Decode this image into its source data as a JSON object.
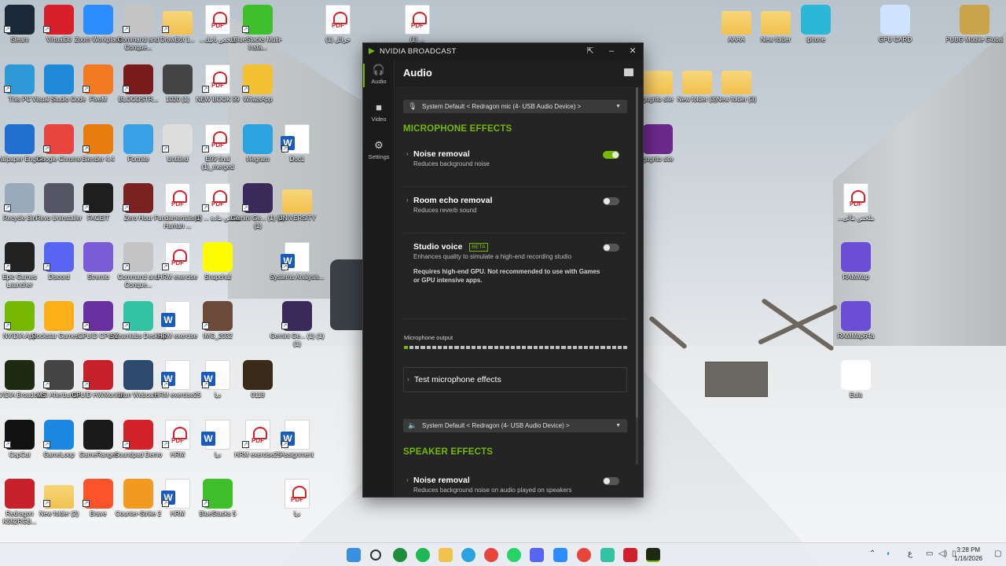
{
  "desktop": {
    "icons_left": [
      {
        "label": "Steam",
        "color": "#1b2838"
      },
      {
        "label": "VirtualDJ",
        "color": "#d8202a"
      },
      {
        "label": "Zoom Workplace",
        "color": "#2d8cff"
      },
      {
        "label": "Command and Conque...",
        "color": "#c4c4c4"
      },
      {
        "label": "DrawBot 1...",
        "color": "folder"
      },
      {
        "label": "...ملخص باتيك",
        "color": "pdf"
      },
      {
        "label": "BlueStacks Multi-Insta...",
        "color": "#3fbf2c"
      },
      {
        "label": "This PC",
        "color": "#2f98d6"
      },
      {
        "label": "Visual Studio Code",
        "color": "#1f8ad8"
      },
      {
        "label": "FiveM",
        "color": "#f37a22"
      },
      {
        "label": "BLOODSTR...",
        "color": "#7a1a1a"
      },
      {
        "label": "1020 (1)",
        "color": "#444"
      },
      {
        "label": "NEW BOOK 99",
        "color": "pdf"
      },
      {
        "label": "WhatsApp",
        "color": "#f2c230"
      },
      {
        "label": "Wallpaper Engine",
        "color": "#1f6fd0"
      },
      {
        "label": "Google Chrome",
        "color": "#e8453c"
      },
      {
        "label": "Blender 4.4",
        "color": "#e87d0d"
      },
      {
        "label": "Fortnite",
        "color": "#39a0e6"
      },
      {
        "label": "Untitled",
        "color": "#ddd"
      },
      {
        "label": "E99 final (1)_merged",
        "color": "pdf"
      },
      {
        "label": "t4egram",
        "color": "#2aa3e0"
      },
      {
        "label": "Doc1",
        "color": "word"
      },
      {
        "label": "Recycle Bin",
        "color": "#9ab"
      },
      {
        "label": "Revo Uninstaller",
        "color": "#556"
      },
      {
        "label": "FACEIT",
        "color": "#1e1e1e"
      },
      {
        "label": "Zero Hour",
        "color": "#7a2222"
      },
      {
        "label": "Fundamentals of Human ...",
        "color": "pdf"
      },
      {
        "label": "ملخص مادة ... (1)",
        "color": "pdf"
      },
      {
        "label": "Gemini Ge... (1) (1) (1)",
        "color": "#3a2a5a"
      },
      {
        "label": "UNIVERSITY",
        "color": "folder"
      },
      {
        "label": "Epic Games Launcher",
        "color": "#222"
      },
      {
        "label": "Discord",
        "color": "#5865f2"
      },
      {
        "label": "Stremio",
        "color": "#7b5bd6"
      },
      {
        "label": "Command and Conque...",
        "color": "#c4c4c4"
      },
      {
        "label": "HRM exercise",
        "color": "pdf"
      },
      {
        "label": "Snapchat",
        "color": "#fffc00"
      },
      {
        "label": "Systems Analysis...",
        "color": "word"
      },
      {
        "label": "NVIDIA App",
        "color": "#76b900"
      },
      {
        "label": "Rockstar Games ...",
        "color": "#fcaf17"
      },
      {
        "label": "CPUID CPU-Z",
        "color": "#6a2fa0"
      },
      {
        "label": "Streamlabs Desktop",
        "color": "#31c3a2"
      },
      {
        "label": "HRM exercise",
        "color": "word"
      },
      {
        "label": "IMG_2032",
        "color": "#6b4a3a"
      },
      {
        "label": "Gemini Ge... (1) (1) (1)",
        "color": "#3a2a5a"
      },
      {
        "label": "NVIDIA Broadcast",
        "color": "#1f2a12"
      },
      {
        "label": "MSI Afterburner",
        "color": "#444"
      },
      {
        "label": "CPUID HWMonitor",
        "color": "#c8202a"
      },
      {
        "label": "Iriun Webcam",
        "color": "#2c4a6c"
      },
      {
        "label": "HRM exercise25",
        "color": "word"
      },
      {
        "label": "دیا",
        "color": "word"
      },
      {
        "label": "0118",
        "color": "#3a2a1a"
      },
      {
        "label": "CapCut",
        "color": "#111"
      },
      {
        "label": "GameLoop",
        "color": "#1c87e0"
      },
      {
        "label": "GameRanger",
        "color": "#1a1a1a"
      },
      {
        "label": "Soundpad Demo",
        "color": "#d2232a"
      },
      {
        "label": "HRM",
        "color": "pdf"
      },
      {
        "label": "دیا",
        "color": "word"
      },
      {
        "label": "HRM exercise25",
        "color": "pdf"
      },
      {
        "label": "Assignment",
        "color": "word"
      },
      {
        "label": "Redragon K552RGB...",
        "color": "#c8202a"
      },
      {
        "label": "New folder (2)",
        "color": "folder"
      },
      {
        "label": "Brave",
        "color": "#fb542b"
      },
      {
        "label": "Counter-Strike 2",
        "color": "#f29a1f"
      },
      {
        "label": "HRM",
        "color": "word"
      },
      {
        "label": "BlueStacks 5",
        "color": "#3fbf2c"
      },
      {
        "label": "دیا",
        "color": "pdf"
      }
    ],
    "icons_right": [
      {
        "label": "AAAA",
        "color": "folder"
      },
      {
        "label": "New folder",
        "color": "folder"
      },
      {
        "label": "iphone",
        "color": "#2bb8d8"
      },
      {
        "label": "GPU CARD",
        "color": "#cfe3ff"
      },
      {
        "label": "PUBG Mobile Global",
        "color": "#c9a44a"
      },
      {
        "label": "gugrito site",
        "color": "folder"
      },
      {
        "label": "New folder (3)",
        "color": "folder"
      },
      {
        "label": "New folder (3)",
        "color": "folder"
      },
      {
        "label": "gugrito site",
        "color": "#6b2a8a"
      },
      {
        "label": "...ملخص هالى",
        "color": "pdf"
      },
      {
        "label": "RAMMap",
        "color": "#6a4fd6"
      },
      {
        "label": "RAMMap64a",
        "color": "#6a4fd6"
      },
      {
        "label": "Eula",
        "color": "#fff"
      }
    ],
    "icons_top_mid": [
      {
        "label": "(1) حرائل",
        "color": "pdf"
      },
      {
        "label": "(1) ...",
        "color": "pdf"
      }
    ]
  },
  "window": {
    "title": "NVIDIA BROADCAST",
    "nav": [
      {
        "label": "Audio",
        "icon": "headset-icon",
        "active": true
      },
      {
        "label": "Video",
        "icon": "camera-icon",
        "active": false
      },
      {
        "label": "Settings",
        "icon": "gear-icon",
        "active": false
      }
    ],
    "page_title": "Audio",
    "mic_device": "System Default < Redragon mic (4- USB Audio Device) >",
    "mic_section_title": "MICROPHONE EFFECTS",
    "mic_effects": [
      {
        "name": "Noise removal",
        "desc": "Reduces background noise",
        "enabled": true
      },
      {
        "name": "Room echo removal",
        "desc": "Reduces reverb sound",
        "enabled": false
      },
      {
        "name": "Studio voice",
        "badge": "BETA",
        "desc": "Enhances quality to simulate a high-end recording studio",
        "warning": "Requires high-end GPU. Not recommended to use with Games or GPU intensive apps.",
        "enabled": false
      }
    ],
    "mic_output_label": "Microphone output",
    "mic_output_level": 0.02,
    "test_mic_label": "Test microphone effects",
    "speaker_device": "System Default < Redragon (4- USB Audio Device) >",
    "speaker_section_title": "SPEAKER EFFECTS",
    "speaker_effects": [
      {
        "name": "Noise removal",
        "desc": "Reduces background noise on audio played on speakers",
        "enabled": false
      }
    ],
    "accent_color": "#76b900"
  },
  "taskbar": {
    "time": "3:28 PM",
    "date": "1/16/2026",
    "lang": "ع"
  }
}
